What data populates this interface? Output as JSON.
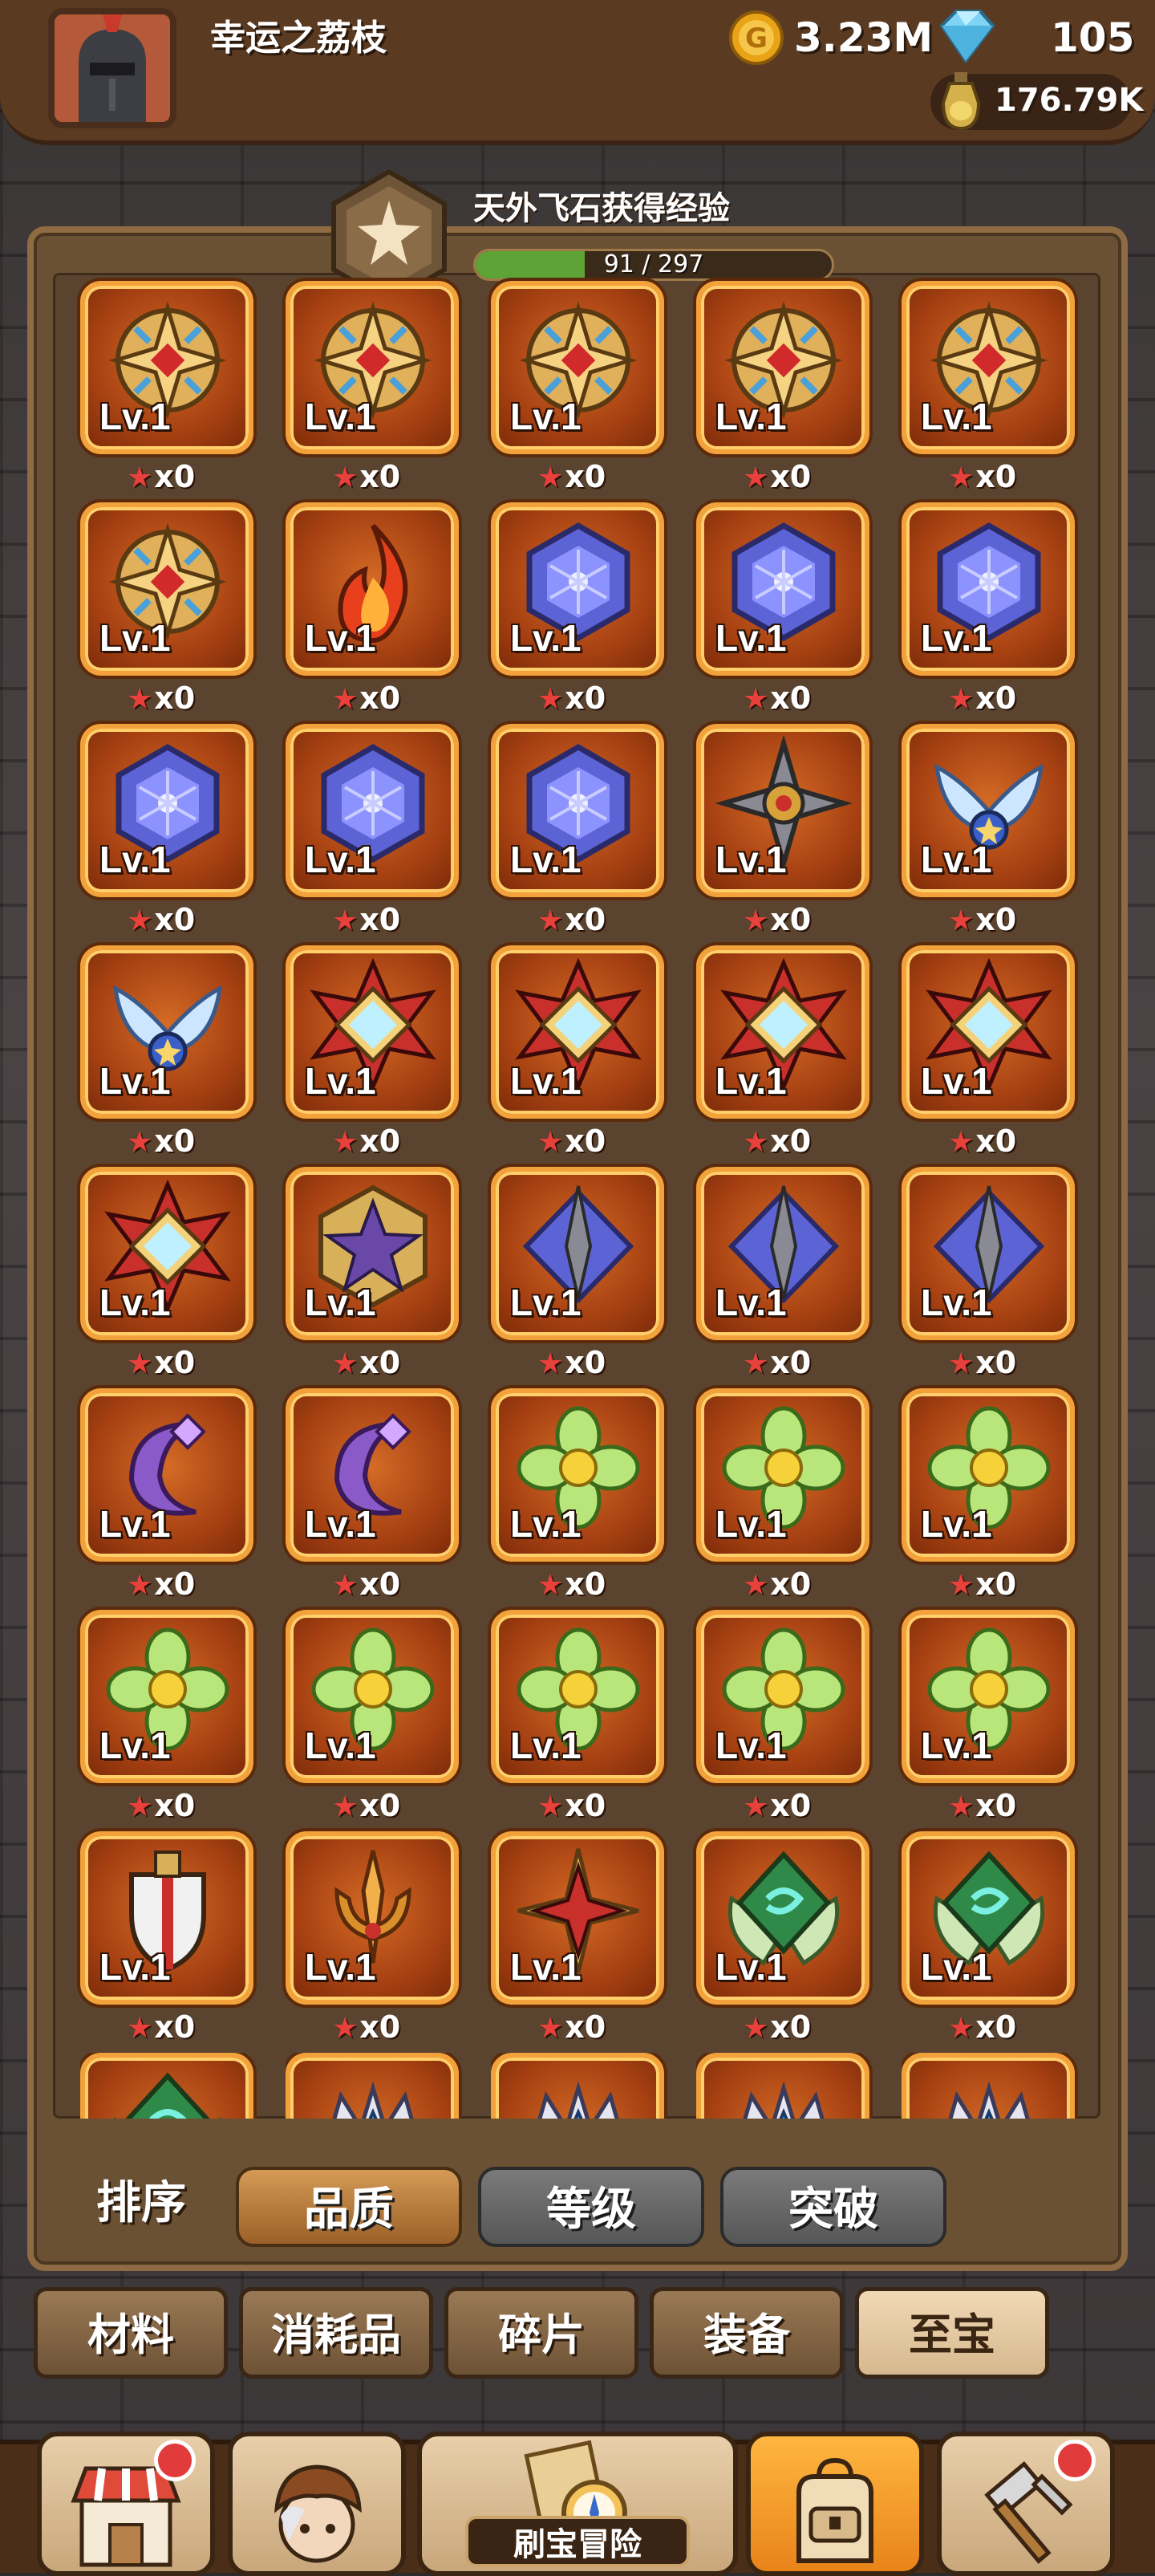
{
  "player": {
    "name": "幸运之荔枝"
  },
  "resources": {
    "gold": "3.23M",
    "gems": "105",
    "bottle": "176.79K"
  },
  "exp": {
    "title": "天外飞石获得经验",
    "current": 91,
    "max": 297,
    "text": "91 / 297"
  },
  "treasures": {
    "level_label": "Lv.1",
    "star_count": "x0",
    "rows": [
      [
        "crest-red",
        "crest-red",
        "crest-red",
        "crest-red",
        "crest-red"
      ],
      [
        "crest-red",
        "flame",
        "blue-hex",
        "blue-hex",
        "blue-hex"
      ],
      [
        "blue-hex",
        "blue-hex",
        "blue-hex",
        "shuriken",
        "wing-emblem"
      ],
      [
        "wing-emblem",
        "diamond-star",
        "diamond-star",
        "diamond-star",
        "diamond-star"
      ],
      [
        "diamond-star",
        "purple-star",
        "spear-diamond",
        "spear-diamond",
        "spear-diamond"
      ],
      [
        "crescent",
        "crescent",
        "flower",
        "flower",
        "flower"
      ],
      [
        "flower",
        "flower",
        "flower",
        "flower",
        "flower"
      ],
      [
        "shield-sword",
        "trident",
        "red-compass",
        "green-rune",
        "green-rune"
      ],
      [
        "green-rune",
        "blue-crown",
        "blue-crown",
        "blue-crown",
        "blue-crown"
      ]
    ]
  },
  "sort": {
    "label": "排序",
    "options": [
      "品质",
      "等级",
      "突破"
    ],
    "active": "品质"
  },
  "categories": {
    "tabs": [
      "材料",
      "消耗品",
      "碎片",
      "装备",
      "至宝"
    ],
    "active": "至宝"
  },
  "bottom_nav": {
    "adventure_label": "刷宝冒险"
  },
  "colors": {
    "cell_border": "#f3a13a",
    "exp_fill": "#5da335",
    "active_tab": "#d6b88e",
    "notification": "#e23b3b"
  }
}
